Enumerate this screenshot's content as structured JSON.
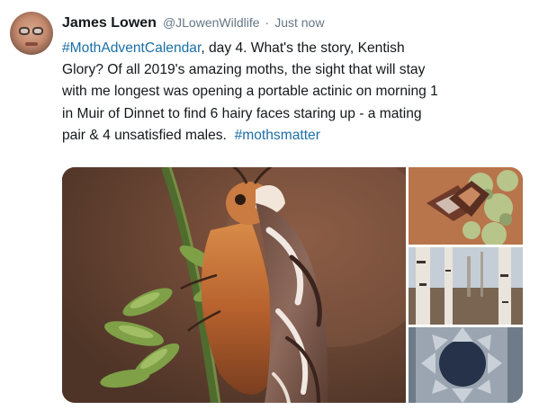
{
  "tweet": {
    "author_name": "James Lowen",
    "handle": "@JLowenWildlife",
    "separator": "·",
    "timestamp": "Just now",
    "text_lines": [
      [
        {
          "text": "#MothAdventCalendar",
          "link": true
        },
        {
          "text": ", day 4. What's the story, Kentish",
          "link": false
        }
      ],
      [
        {
          "text": "Glory? Of all 2019's amazing moths, the sight that will stay",
          "link": false
        }
      ],
      [
        {
          "text": "with me longest was opening a portable actinic on morning 1",
          "link": false
        }
      ],
      [
        {
          "text": "in Muir of Dinnet to find 6 hairy faces staring up - a mating",
          "link": false
        }
      ],
      [
        {
          "text": "pair & 4 unsatisfied males.  ",
          "link": false
        },
        {
          "text": "#mothsmatter",
          "link": true
        }
      ]
    ],
    "colors": {
      "link": "#1b6fa6",
      "text": "#14171a",
      "muted": "#657786"
    }
  }
}
